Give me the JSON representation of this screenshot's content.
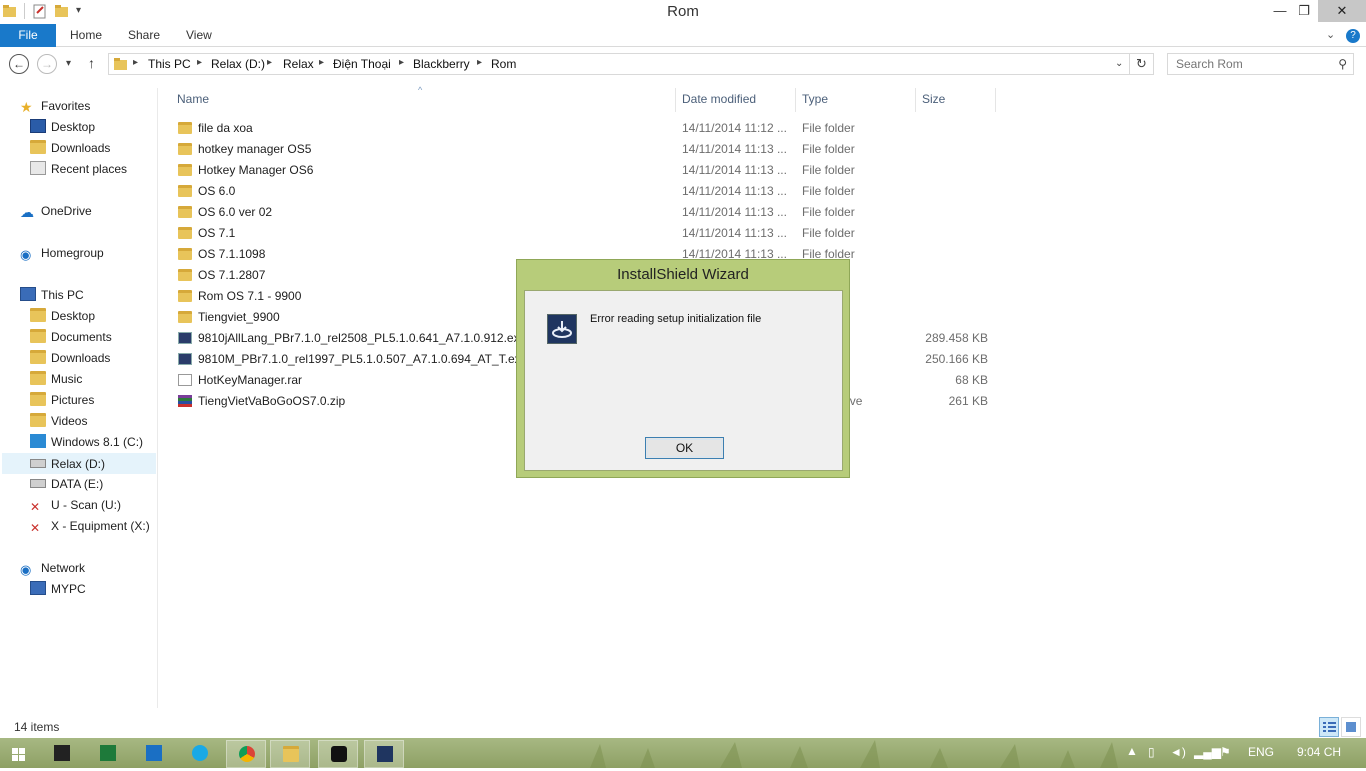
{
  "window": {
    "title": "Rom"
  },
  "ribbon": {
    "file": "File",
    "tabs": [
      "Home",
      "Share",
      "View"
    ]
  },
  "address": {
    "crumbs": [
      "This PC",
      "Relax (D:)",
      "Relax",
      "Điện Thoại",
      "Blackberry",
      "Rom"
    ],
    "search_placeholder": "Search Rom"
  },
  "nav": {
    "favorites": "Favorites",
    "desktop": "Desktop",
    "downloads": "Downloads",
    "recent": "Recent places",
    "onedrive": "OneDrive",
    "homegroup": "Homegroup",
    "thispc": "This PC",
    "pc_desktop": "Desktop",
    "documents": "Documents",
    "pc_downloads": "Downloads",
    "music": "Music",
    "pictures": "Pictures",
    "videos": "Videos",
    "drive_c": "Windows 8.1 (C:)",
    "drive_d": "Relax (D:)",
    "drive_e": "DATA (E:)",
    "drive_u": "U - Scan (U:)",
    "drive_x": "X - Equipment (X:)",
    "network": "Network",
    "mypc": "MYPC"
  },
  "columns": {
    "name": "Name",
    "date": "Date modified",
    "type": "Type",
    "size": "Size"
  },
  "files": [
    {
      "name": "file da xoa",
      "date": "14/11/2014 11:12 ...",
      "type": "File folder",
      "size": "",
      "icon": "folder-icon"
    },
    {
      "name": "hotkey manager OS5",
      "date": "14/11/2014 11:13 ...",
      "type": "File folder",
      "size": "",
      "icon": "folder-icon"
    },
    {
      "name": "Hotkey Manager OS6",
      "date": "14/11/2014 11:13 ...",
      "type": "File folder",
      "size": "",
      "icon": "folder-icon"
    },
    {
      "name": "OS 6.0",
      "date": "14/11/2014 11:13 ...",
      "type": "File folder",
      "size": "",
      "icon": "folder-icon"
    },
    {
      "name": "OS 6.0 ver 02",
      "date": "14/11/2014 11:13 ...",
      "type": "File folder",
      "size": "",
      "icon": "folder-icon"
    },
    {
      "name": "OS 7.1",
      "date": "14/11/2014 11:13 ...",
      "type": "File folder",
      "size": "",
      "icon": "folder-icon"
    },
    {
      "name": "OS 7.1.1098",
      "date": "14/11/2014 11:13 ...",
      "type": "File folder",
      "size": "",
      "icon": "folder-icon"
    },
    {
      "name": "OS 7.1.2807",
      "date": "",
      "type": "r",
      "size": "",
      "icon": "folder-icon"
    },
    {
      "name": "Rom OS 7.1 - 9900",
      "date": "",
      "type": "r",
      "size": "",
      "icon": "folder-icon"
    },
    {
      "name": "Tiengviet_9900",
      "date": "",
      "type": "r",
      "size": "",
      "icon": "folder-icon"
    },
    {
      "name": "9810jAllLang_PBr7.1.0_rel2508_PL5.1.0.641_A7.1.0.912.exe",
      "date": "",
      "type": "on",
      "size": "289.458 KB",
      "icon": "installer-icon"
    },
    {
      "name": "9810M_PBr7.1.0_rel1997_PL5.1.0.507_A7.1.0.694_AT_T.exe",
      "date": "",
      "type": "on",
      "size": "250.166 KB",
      "icon": "installer-icon"
    },
    {
      "name": "HotKeyManager.rar",
      "date": "",
      "type": "",
      "size": "68 KB",
      "icon": "rar-icon"
    },
    {
      "name": "TiengVietVaBoGoOS7.0.zip",
      "date": "",
      "type": "ZIP archive",
      "size": "261 KB",
      "icon": "zip-icon"
    }
  ],
  "status": {
    "items": "14 items"
  },
  "dialog": {
    "title": "InstallShield Wizard",
    "message": "Error reading setup initialization file",
    "ok": "OK"
  },
  "taskbar": {
    "language": "ENG",
    "clock": "9:04 CH",
    "colors": {
      "bar": "#9aad70",
      "dialog_frame": "#b7cc7a",
      "file_tab": "#1979ca"
    }
  }
}
